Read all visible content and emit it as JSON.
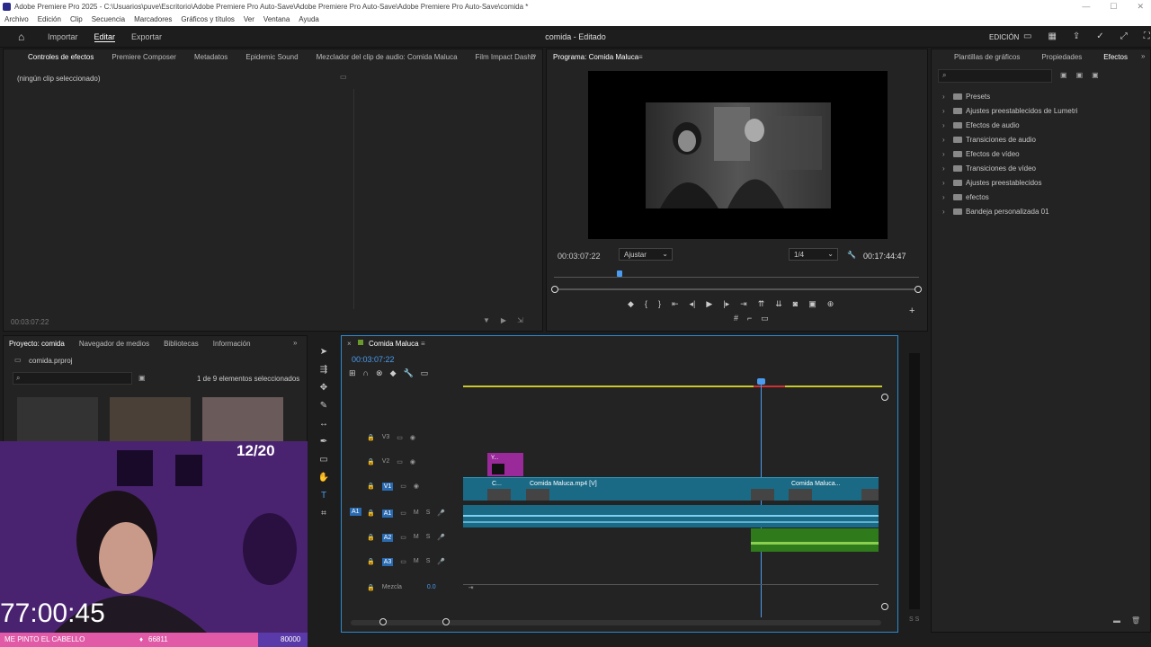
{
  "window": {
    "title": "Adobe Premiere Pro 2025 - C:\\Usuarios\\puve\\Escritorio\\Adobe Premiere Pro Auto-Save\\Adobe Premiere Pro Auto-Save\\Adobe Premiere Pro Auto-Save\\comida *"
  },
  "menu": [
    "Archivo",
    "Edición",
    "Clip",
    "Secuencia",
    "Marcadores",
    "Gráficos y títulos",
    "Ver",
    "Ventana",
    "Ayuda"
  ],
  "topnav": {
    "import": "Importar",
    "edit": "Editar",
    "export": "Exportar",
    "project_title": "comida - Editado",
    "workspace": "EDICIÓN"
  },
  "effect_controls": {
    "tabs": [
      "Controles de efectos",
      "Premiere Composer",
      "Metadatos",
      "Epidemic Sound",
      "Mezclador del clip de audio: Comida Maluca",
      "Film Impact Dashb"
    ],
    "empty": "(ningún clip seleccionado)",
    "timecode": "00:03:07:22"
  },
  "program": {
    "title": "Programa: Comida Maluca",
    "timecode": "00:03:07:22",
    "fit": "Ajustar",
    "resolution": "1/4",
    "duration": "00:17:44:47"
  },
  "right_panel": {
    "tabs": [
      "Plantillas de gráficos",
      "Propiedades",
      "Efectos"
    ],
    "tree": [
      "Presets",
      "Ajustes preestablecidos de Lumetri",
      "Efectos de audio",
      "Transiciones de audio",
      "Efectos de vídeo",
      "Transiciones de vídeo",
      "Ajustes preestablecidos",
      "efectos",
      "Bandeja personalizada 01"
    ]
  },
  "project": {
    "tabs": [
      "Proyecto: comida",
      "Navegador de medios",
      "Bibliotecas",
      "Información"
    ],
    "file": "comida.prproj",
    "count": "1 de 9 elementos seleccionados"
  },
  "timeline": {
    "title": "Comida Maluca",
    "timecode": "00:03:07:22",
    "tracks": [
      "V3",
      "V2",
      "V1",
      "A1",
      "A2",
      "A3"
    ],
    "source_a1": "A1",
    "clip_v1_a": "Comida Maluca.mp4 [V]",
    "clip_v1_b": "Comida Maluca...",
    "clip_v1_small": "C...",
    "clip_v2": "Y...",
    "mix_label": "Mezcla",
    "mix_value": "0.0",
    "ms": [
      "M",
      "S"
    ]
  },
  "overlay": {
    "counter": "12/20",
    "clock": "77:00:45",
    "bar_left": "ME PINTO EL CABELLO",
    "bar_mid": "66811",
    "bar_right": "80000"
  },
  "colors": {
    "accent": "#4a9cf0",
    "clip": "#1a6a86",
    "audio_green": "#2f7a1a",
    "overlay": "#e05aa8"
  }
}
